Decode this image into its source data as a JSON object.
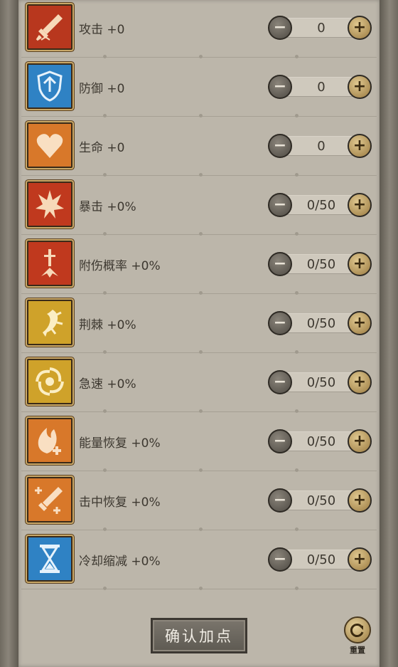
{
  "stats": [
    {
      "label": "攻击 +0",
      "value": "0",
      "icon": "sword-icon",
      "color": "#b8371e"
    },
    {
      "label": "防御 +0",
      "value": "0",
      "icon": "shield-icon",
      "color": "#2f82c4"
    },
    {
      "label": "生命 +0",
      "value": "0",
      "icon": "heart-icon",
      "color": "#d8782a"
    },
    {
      "label": "暴击 +0%",
      "value": "0/50",
      "icon": "burst-icon",
      "color": "#c0391e"
    },
    {
      "label": "附伤概率 +0%",
      "value": "0/50",
      "icon": "dagger-impact-icon",
      "color": "#c0391e"
    },
    {
      "label": "荆棘 +0%",
      "value": "0/50",
      "icon": "thorn-icon",
      "color": "#cfa22a"
    },
    {
      "label": "急速 +0%",
      "value": "0/50",
      "icon": "swirl-icon",
      "color": "#cfa22a"
    },
    {
      "label": "能量恢复 +0%",
      "value": "0/50",
      "icon": "flame-plus-icon",
      "color": "#d8782a"
    },
    {
      "label": "击中恢复 +0%",
      "value": "0/50",
      "icon": "sword-plus-icon",
      "color": "#d8782a"
    },
    {
      "label": "冷却缩减 +0%",
      "value": "0/50",
      "icon": "hourglass-icon",
      "color": "#2f82c4"
    }
  ],
  "controls": {
    "minus": "−",
    "plus": "+"
  },
  "footer": {
    "confirm_label": "确认加点",
    "reset_label": "重置"
  }
}
